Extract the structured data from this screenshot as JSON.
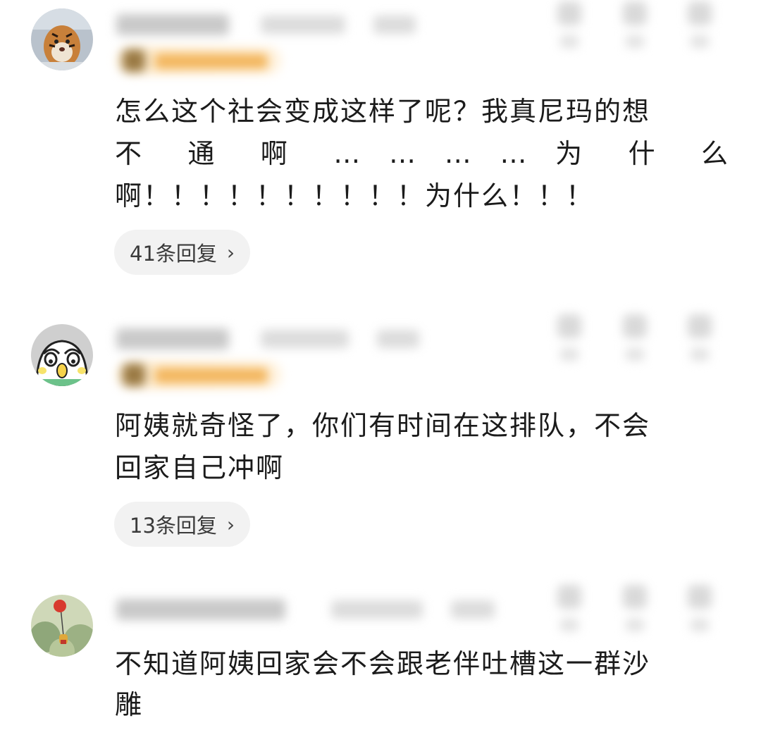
{
  "comments": [
    {
      "text_lines": [
        "怎么这个社会变成这样了呢？我真尼玛的想",
        "不 通 啊 … … … … 为 什 么",
        "啊！！！！！！！！！！为什么！！！"
      ],
      "replies_label": "41条回复",
      "chevron": "›",
      "avatar": "tiger-avatar"
    },
    {
      "text_lines": [
        "阿姨就奇怪了，你们有时间在这排队，不会",
        "回家自己冲啊"
      ],
      "replies_label": "13条回复",
      "chevron": "›",
      "avatar": "cartoon-face-avatar"
    },
    {
      "text_lines": [
        "不知道阿姨回家会不会跟老伴吐槽这一群沙",
        "雕"
      ],
      "avatar": "balloon-illustration-avatar"
    }
  ],
  "colors": {
    "text": "#1b1b1b",
    "reply_pill_bg": "#f2f2f2",
    "badge_orange": "#f3b65d"
  }
}
